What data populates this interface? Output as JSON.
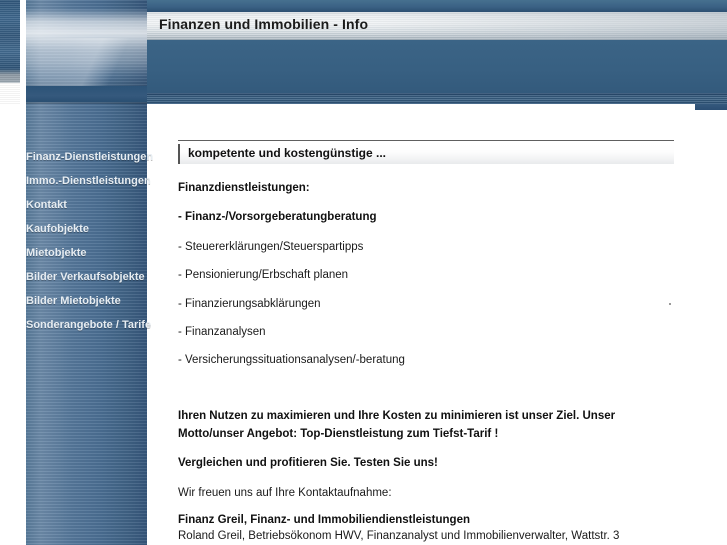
{
  "header": {
    "title": "Finanzen und Immobilien - Info",
    "plate_color": "#3a6184",
    "title_band_color": "#e8ecef"
  },
  "sidebar": {
    "items": [
      {
        "label": "Finanz-Dienstleistungen"
      },
      {
        "label": "Immo.-Dienstleistungen"
      },
      {
        "label": "Kontakt"
      },
      {
        "label": "Kaufobjekte"
      },
      {
        "label": "Mietobjekte"
      },
      {
        "label": "Bilder Verkaufsobjekte"
      },
      {
        "label": "Bilder Mietobjekte"
      },
      {
        "label": "Sonderangebote / Tarife"
      }
    ]
  },
  "main": {
    "banner": "kompetente und kostengünstige ...",
    "section_heading": "Finanzdienstleistungen:",
    "services": [
      "- Finanz-/Vorsorgeberatungberatung",
      "- Steuererklärungen/Steuerspartipps",
      "- Pensionierung/Erbschaft planen",
      "- Finanzierungsabklärungen",
      "- Finanzanalysen",
      "- Versicherungssituationsanalysen/-beratung"
    ],
    "pitch_line_1": "Ihren Nutzen zu maximieren und Ihre Kosten zu minimieren ist unser Ziel. Unser",
    "pitch_line_2": "Motto/unser Angebot: Top-Dienstleistung zum Tiefst-Tarif !",
    "call_to_action": "Vergleichen und profitieren Sie. Testen Sie uns!",
    "contact_intro": "Wir freuen uns auf Ihre Kontaktaufnahme:",
    "company_name": "Finanz Greil, Finanz- und Immobiliendienstleistungen",
    "company_details": "Roland Greil, Betriebsökonom HWV, Finanzanalyst und Immobilienverwalter, Wattstr. 3"
  }
}
